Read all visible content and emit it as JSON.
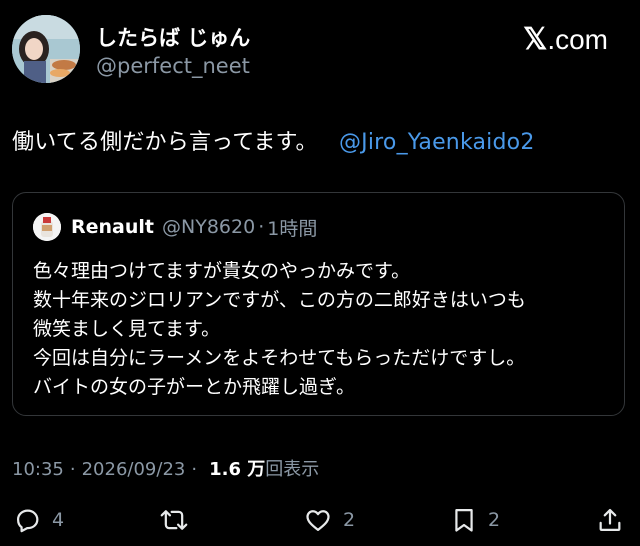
{
  "author": {
    "display_name": "したらば じゅん",
    "handle": "@perfect_neet"
  },
  "brand": {
    "label": ".com",
    "x_mark": "𝕏"
  },
  "tweet": {
    "text": "働いてる側だから言ってます。",
    "mention": "@Jiro_Yaenkaido2"
  },
  "quote": {
    "name": "Renault",
    "handle": "@NY8620",
    "dot": "·",
    "time": "1時間",
    "lines": [
      "色々理由つけてますが貴女のやっかみです。",
      "数十年来のジロリアンですが、この方の二郎好きはいつも",
      "微笑ましく見てます。",
      "今回は自分にラーメンをよそわせてもらっただけですし。",
      "バイトの女の子がーとか飛躍し過ぎ。"
    ]
  },
  "meta": {
    "time": "10:35",
    "sep1": "·",
    "date": "2026/09/23",
    "sep2": "·",
    "views_count": "1.6 万",
    "views_label": "回表示"
  },
  "actions": {
    "replies": "4",
    "reposts": "",
    "likes": "2",
    "bookmarks": "2"
  },
  "icons": {
    "reply": "reply-icon",
    "repost": "repost-icon",
    "like": "heart-icon",
    "bookmark": "bookmark-icon",
    "share": "share-icon"
  },
  "colors": {
    "background": "#000000",
    "text": "#ffffff",
    "secondary": "#8b98a5",
    "link": "#4a99e9",
    "border": "#333639"
  }
}
